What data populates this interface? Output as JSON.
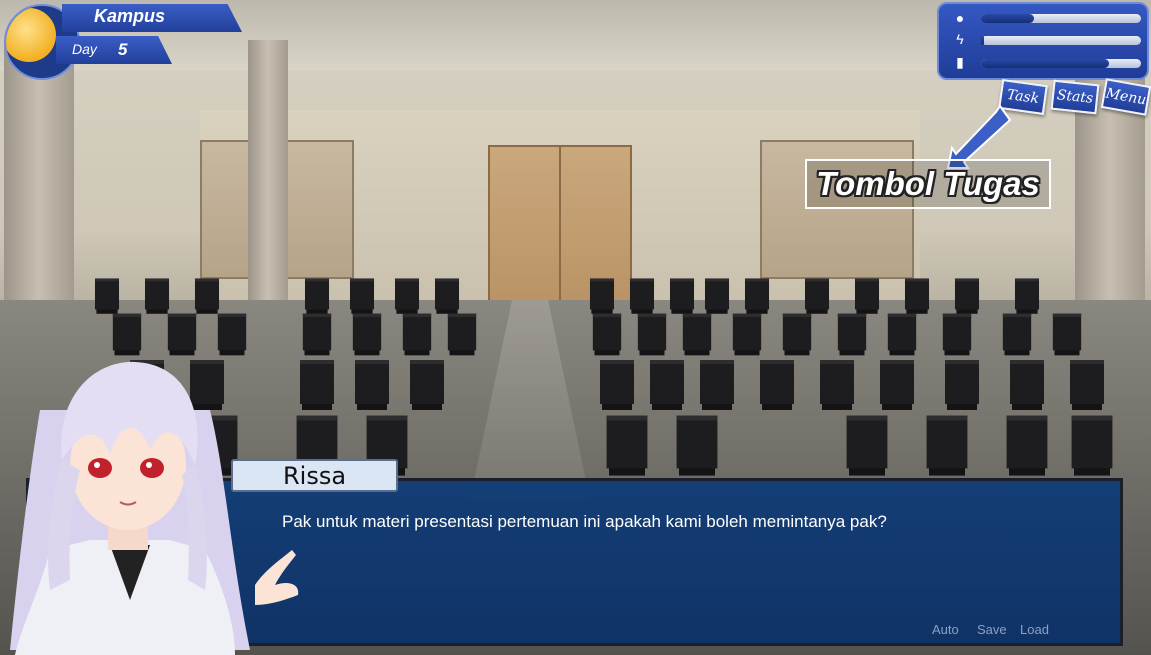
{
  "location": {
    "name": "Kampus",
    "day_label": "Day",
    "day_number": "5"
  },
  "stats": [
    {
      "icon": "food-icon",
      "glyph": "●",
      "level": 0.33
    },
    {
      "icon": "energy-icon",
      "glyph": "ϟ",
      "level": 0.02
    },
    {
      "icon": "battery-icon",
      "glyph": "▮",
      "level": 0.8
    }
  ],
  "buttons": {
    "task": "Task",
    "stats": "Stats",
    "menu": "Menu"
  },
  "annotation": {
    "label": "Tombol Tugas"
  },
  "dialogue": {
    "speaker": "Rissa",
    "text": "Pak untuk materi presentasi pertemuan ini apakah kami boleh memintanya pak?"
  },
  "quick_menu": {
    "auto": "Auto",
    "save": "Save",
    "load": "Load"
  },
  "colors": {
    "hud_blue": "#2a4db5",
    "dialog_blue": "#0c3a78",
    "sun": "#f2b022"
  }
}
